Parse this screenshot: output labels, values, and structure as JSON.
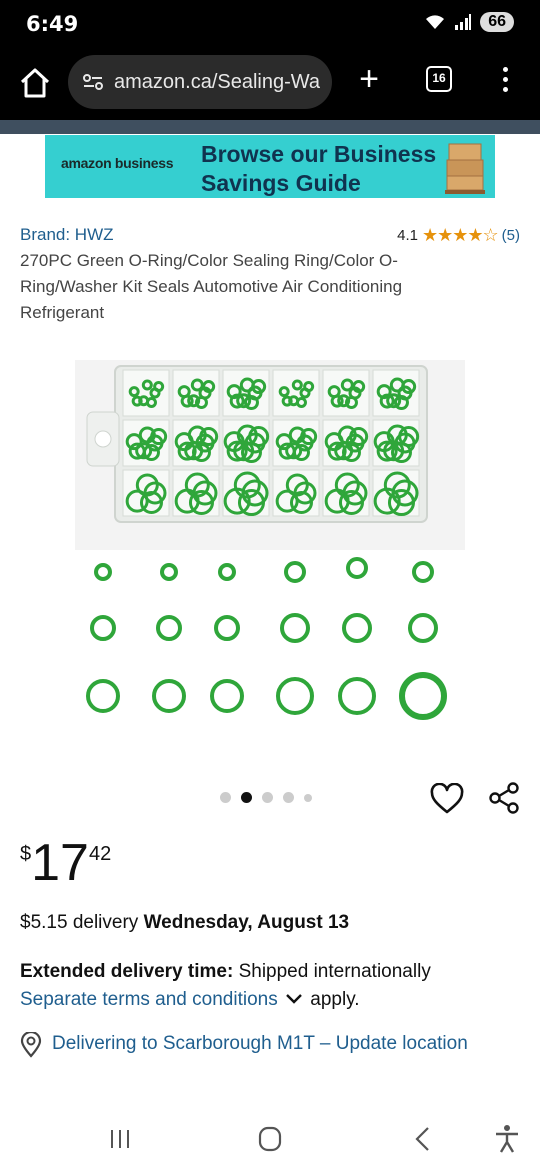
{
  "status_bar": {
    "time": "6:49",
    "battery": "66"
  },
  "browser": {
    "url": "amazon.ca/Sealing-Wa",
    "tab_count": "16"
  },
  "banner": {
    "logo": "amazon business",
    "line1": "Browse our Business",
    "line2": "Savings Guide"
  },
  "product": {
    "brand": "Brand: HWZ",
    "rating_value": "4.1",
    "stars": "★★★★☆",
    "rating_count": "(5)",
    "title": "270PC Green O-Ring/Color Sealing Ring/Color O-Ring/Washer Kit Seals Automotive Air Conditioning Refrigerant",
    "image_count": 5,
    "active_image": 2
  },
  "price": {
    "currency": "$",
    "whole": "17",
    "fraction": "42"
  },
  "delivery": {
    "prefix": "$5.15 delivery ",
    "date": "Wednesday, August 13"
  },
  "extended": {
    "label": "Extended delivery time:",
    "text": " Shipped internationally",
    "link": "Separate terms and conditions",
    "suffix": "apply."
  },
  "location": {
    "text": "Delivering to Scarborough M1T – Update location"
  },
  "colors": {
    "link": "#1f5e8e",
    "star": "#e6920c",
    "oring": "#2fa63a",
    "banner": "#35cfd0"
  }
}
